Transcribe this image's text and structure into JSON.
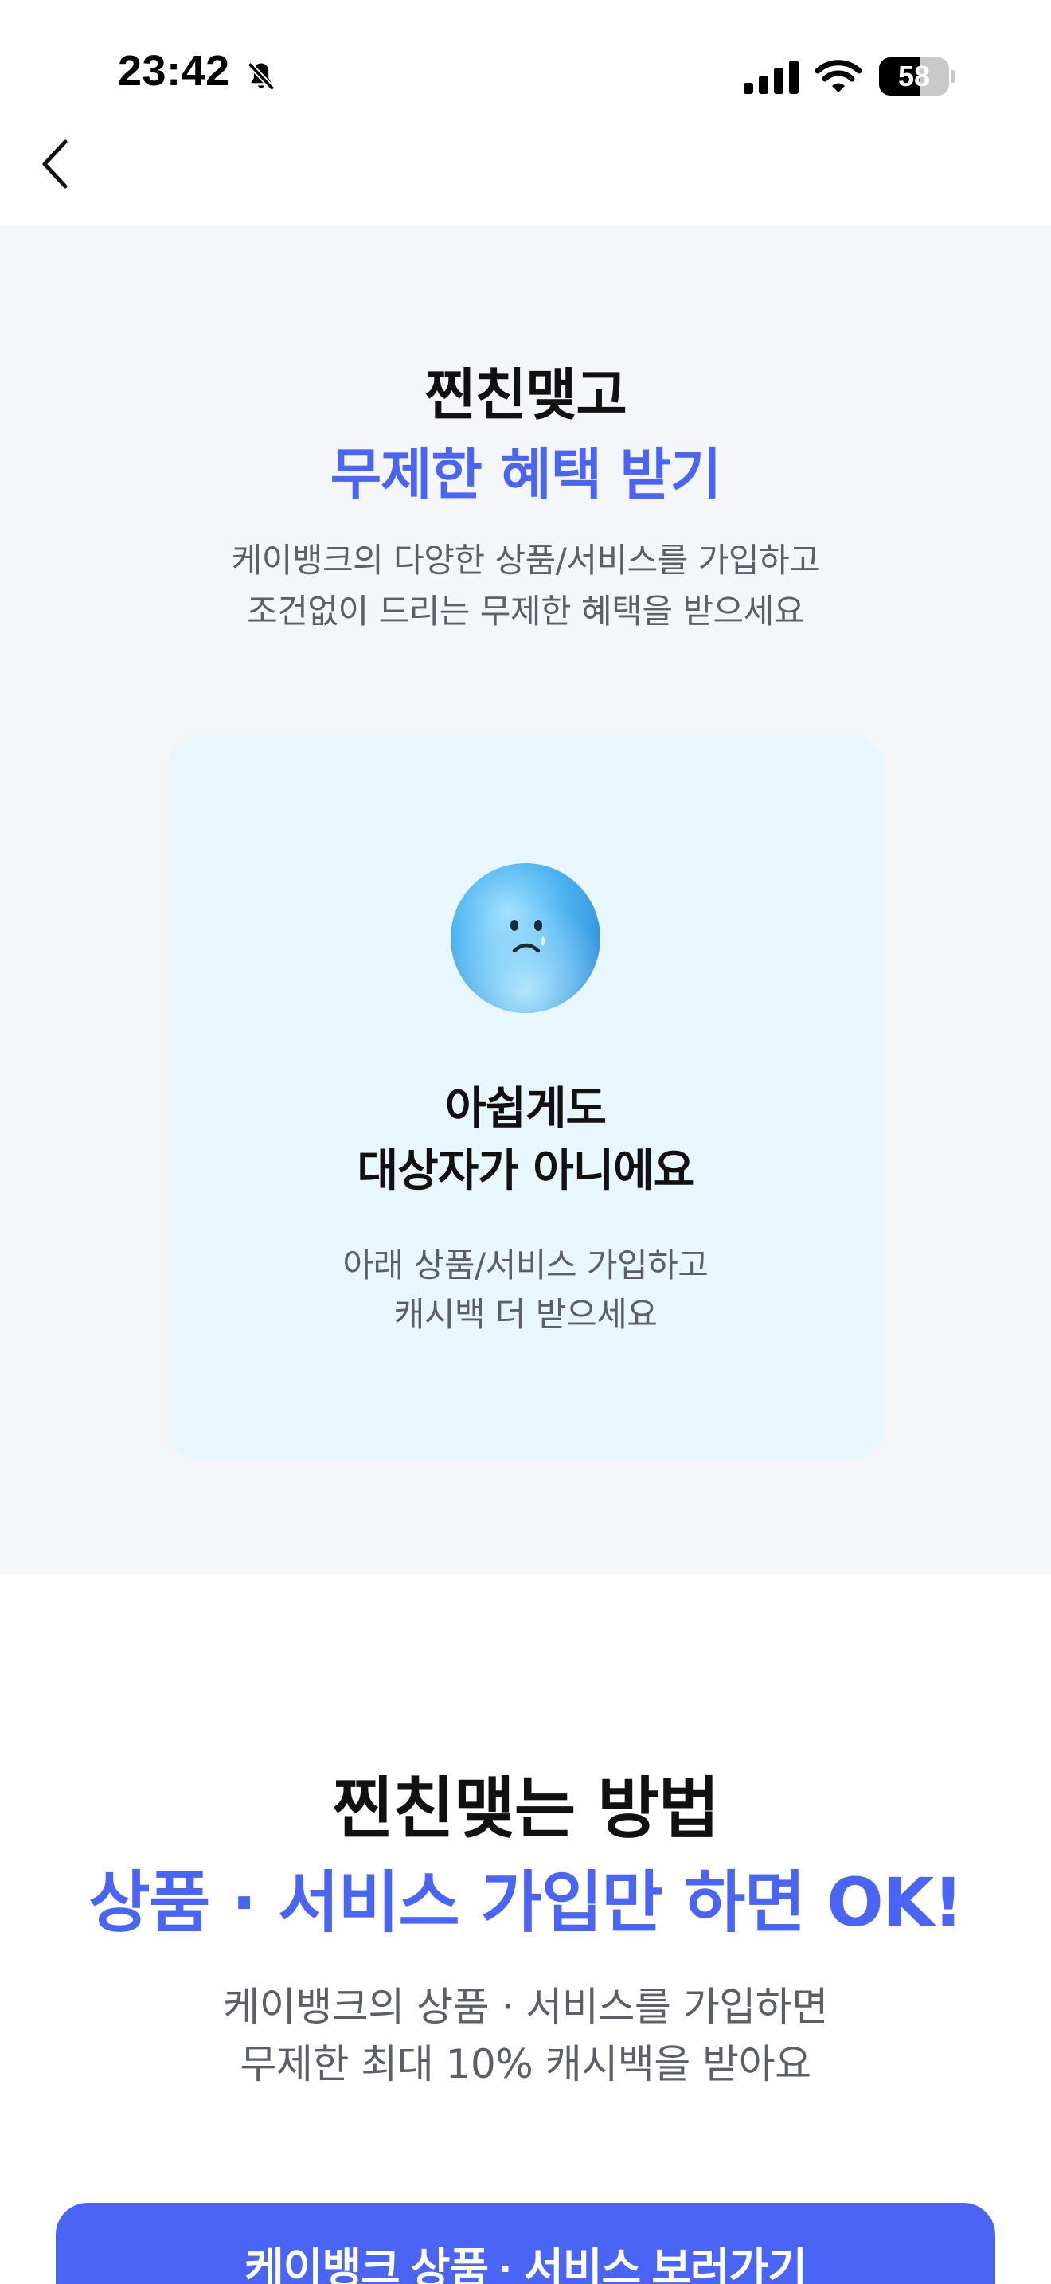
{
  "status_bar": {
    "time": "23:42",
    "battery_level": "58",
    "battery_fraction": 0.58,
    "icons": [
      "bell-slash-icon",
      "cellular-signal-icon",
      "wifi-icon",
      "battery-icon"
    ]
  },
  "nav": {
    "back_icon": "chevron-left-icon"
  },
  "hero": {
    "title_line1": "찐친맺고",
    "title_line2": "무제한 혜택 받기",
    "desc_line1": "케이뱅크의 다양한 상품/서비스를 가입하고",
    "desc_line2": "조건없이 드리는 무제한 혜택을 받으세요"
  },
  "notice_card": {
    "icon": "sad-face-icon",
    "title_line1": "아쉽게도",
    "title_line2": "대상자가 아니에요",
    "desc_line1": "아래 상품/서비스 가입하고",
    "desc_line2": "캐시백 더 받으세요"
  },
  "method": {
    "title": "찐친맺는 방법",
    "subtitle": "상품 · 서비스 가입만 하면 OK!",
    "desc_line1": "케이뱅크의 상품 · 서비스를 가입하면",
    "desc_line2": "무제한 최대 10% 캐시백을 받아요"
  },
  "cta": {
    "label": "케이뱅크 상품 · 서비스 보러가기"
  },
  "colors": {
    "accent": "#4a64f5",
    "section_bg": "#f5f6fa",
    "card_bg": "#e8f6fd",
    "body_text": "#111111",
    "secondary_text": "#5c5f66"
  }
}
